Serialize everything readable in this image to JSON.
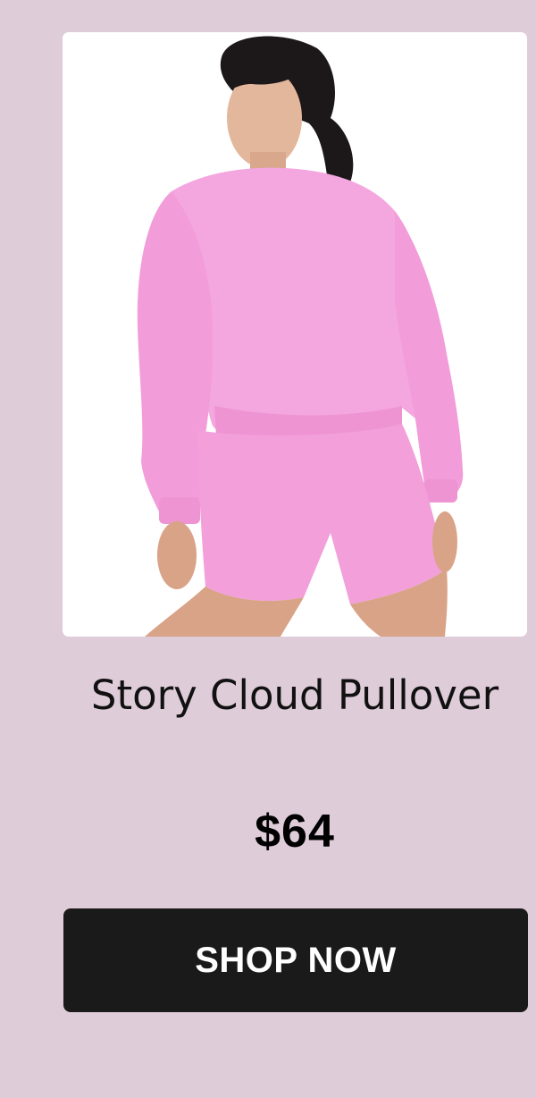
{
  "product": {
    "image_alt": "Woman wearing a pink crewneck pullover and matching pink shorts",
    "title": "Story Cloud Pullover",
    "price": "$64"
  },
  "cta": {
    "label": "SHOP NOW"
  },
  "colors": {
    "background": "#dfccd9",
    "card": "#ffffff",
    "garment_pink": "#f4a6df",
    "button": "#1a1a1a",
    "button_text": "#ffffff"
  }
}
